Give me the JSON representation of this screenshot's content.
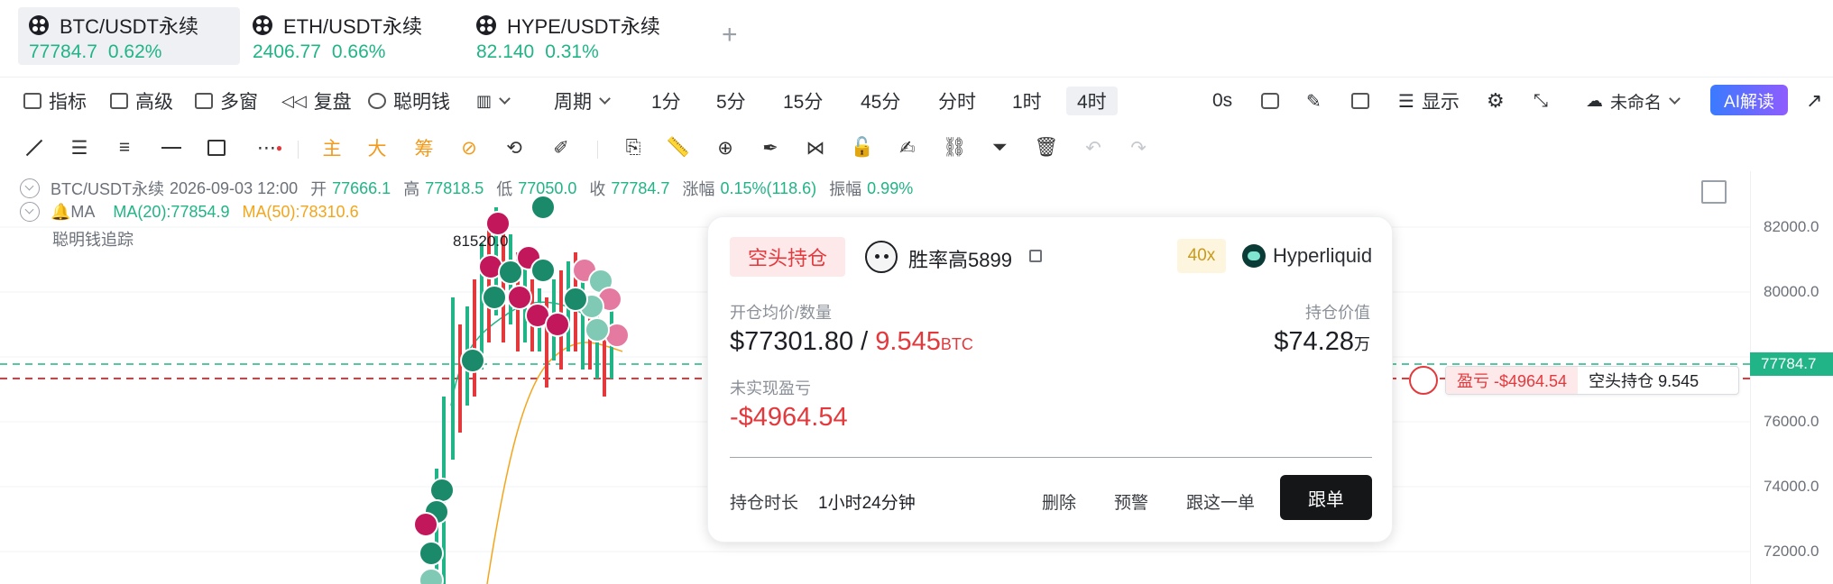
{
  "tickers": [
    {
      "symbol": "BTC/USDT永续",
      "price": "77784.7",
      "change": "0.62%",
      "active": true
    },
    {
      "symbol": "ETH/USDT永续",
      "price": "2406.77",
      "change": "0.66%",
      "active": false
    },
    {
      "symbol": "HYPE/USDT永续",
      "price": "82.140",
      "change": "0.31%",
      "active": false
    }
  ],
  "add_tab": "+",
  "toolbar": {
    "indicators": "指标",
    "advanced": "高级",
    "multi_window": "多窗",
    "replay": "复盘",
    "smart_money": "聪明钱",
    "period": "周期",
    "intervals": [
      "1分",
      "5分",
      "15分",
      "45分",
      "分时",
      "1时",
      "4时"
    ],
    "active_interval": "4时",
    "countdown": "0s",
    "display": "显示",
    "layout_name": "未命名",
    "ai_label": "AI解读"
  },
  "drawing_tools": {
    "main": "主",
    "big": "大",
    "chip": "筹"
  },
  "legend": {
    "symbol": "BTC/USDT永续",
    "datetime": "2026-09-03 12:00",
    "open_label": "开",
    "open": "77666.1",
    "high_label": "高",
    "high": "77818.5",
    "low_label": "低",
    "low": "77050.0",
    "close_label": "收",
    "close": "77784.7",
    "change_label": "涨幅",
    "change": "0.15%(118.6)",
    "amplitude_label": "振幅",
    "amplitude": "0.99%",
    "ma_label": "MA",
    "ma20": "MA(20):77854.9",
    "ma50": "MA(50):78310.6",
    "smart_money_track": "聪明钱追踪"
  },
  "chart_annotation": "81520.0",
  "y_axis": [
    "82000.0",
    "80000.0",
    "76000.0",
    "74000.0",
    "72000.0"
  ],
  "current_price": "77784.7",
  "colors": {
    "up": "#20b486",
    "down": "#e4393c",
    "ma50": "#f3a51b",
    "accent": "#3a7bff"
  },
  "card": {
    "side": "空头持仓",
    "trader": "胜率高5899",
    "leverage": "40x",
    "exchange": "Hyperliquid",
    "entry_label": "开仓均价/数量",
    "entry_price": "$77301.80",
    "separator": "/",
    "quantity": "9.545",
    "quantity_unit": "BTC",
    "value_label": "持仓价值",
    "value": "$74.28",
    "value_unit": "万",
    "pnl_label": "未实现盈亏",
    "pnl": "-$4964.54",
    "duration_label": "持仓时长",
    "duration": "1小时24分钟",
    "delete": "删除",
    "alert": "预警",
    "follow_once": "跟这一单",
    "follow": "跟单"
  },
  "position_tag": {
    "pnl": "盈亏 -$4964.54",
    "position": "空头持仓 9.545"
  }
}
